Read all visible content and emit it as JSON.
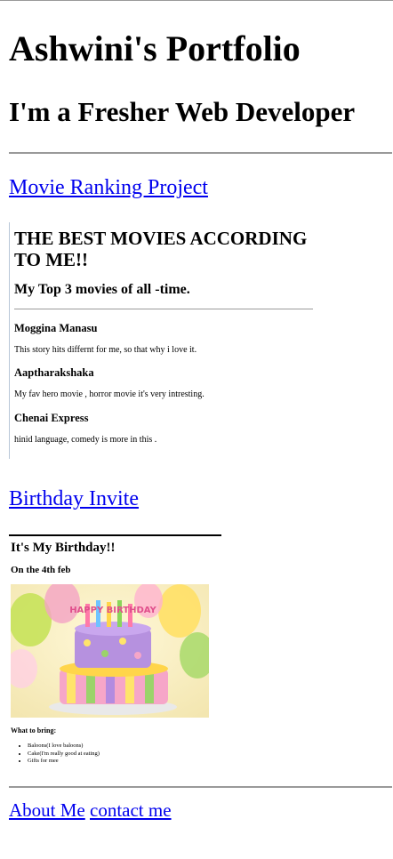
{
  "header": {
    "title": "Ashwini's Portfolio",
    "subtitle": "I'm a Fresher Web Developer"
  },
  "projects": {
    "movie_link": "Movie Ranking Project",
    "birthday_link": "Birthday Invite"
  },
  "movie_page": {
    "title": "THE BEST MOVIES ACCORDING TO ME!!",
    "subtitle": "My Top 3 movies of all -time.",
    "movies": [
      {
        "name": "Moggina Manasu",
        "desc": "This story hits differnt for me, so that why i love it."
      },
      {
        "name": "Aaptharakshaka",
        "desc": "My fav hero movie , horror movie it's very intresting."
      },
      {
        "name": "Chenai Express",
        "desc": "hinid language, comedy is more in this ."
      }
    ]
  },
  "birthday_page": {
    "title": "It's My Birthday!!",
    "date": "On the 4th feb",
    "cake_text": "HAPPY BIRTHDAY",
    "bring_heading": "What to bring:",
    "items": [
      "Baloons(I love baloons)",
      "Cake(I'm really good at eating)",
      "Gifts for mee"
    ]
  },
  "footer": {
    "about_link": "About Me",
    "contact_link": "contact me"
  }
}
